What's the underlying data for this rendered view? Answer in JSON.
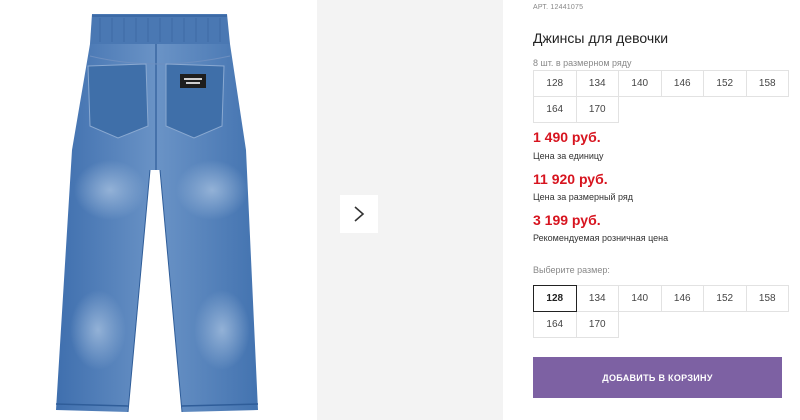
{
  "product": {
    "sku": "АРТ. 12441075",
    "title": "Джинсы для девочки"
  },
  "pack": {
    "label": "8 шт. в размерном ряду",
    "sizes": [
      "128",
      "134",
      "140",
      "146",
      "152",
      "158",
      "164",
      "170"
    ]
  },
  "prices": [
    {
      "value": "1 490 руб.",
      "note": "Цена за единицу"
    },
    {
      "value": "11 920 руб.",
      "note": "Цена за размерный ряд"
    },
    {
      "value": "3 199 руб.",
      "note": "Рекомендуемая розничная цена"
    }
  ],
  "size_select": {
    "label": "Выберите размер:",
    "sizes": [
      "128",
      "134",
      "140",
      "146",
      "152",
      "158",
      "164",
      "170"
    ],
    "selected": "128"
  },
  "cart_button_label": "ДОБАВИТЬ В КОРЗИНУ",
  "icons": {
    "next": "chevron-right-icon",
    "product_image": "jeans-image",
    "patch": "label-patch"
  },
  "colors": {
    "price": "#d7141f",
    "cart_button": "#7d61a3",
    "denim": "#4a78b3"
  }
}
